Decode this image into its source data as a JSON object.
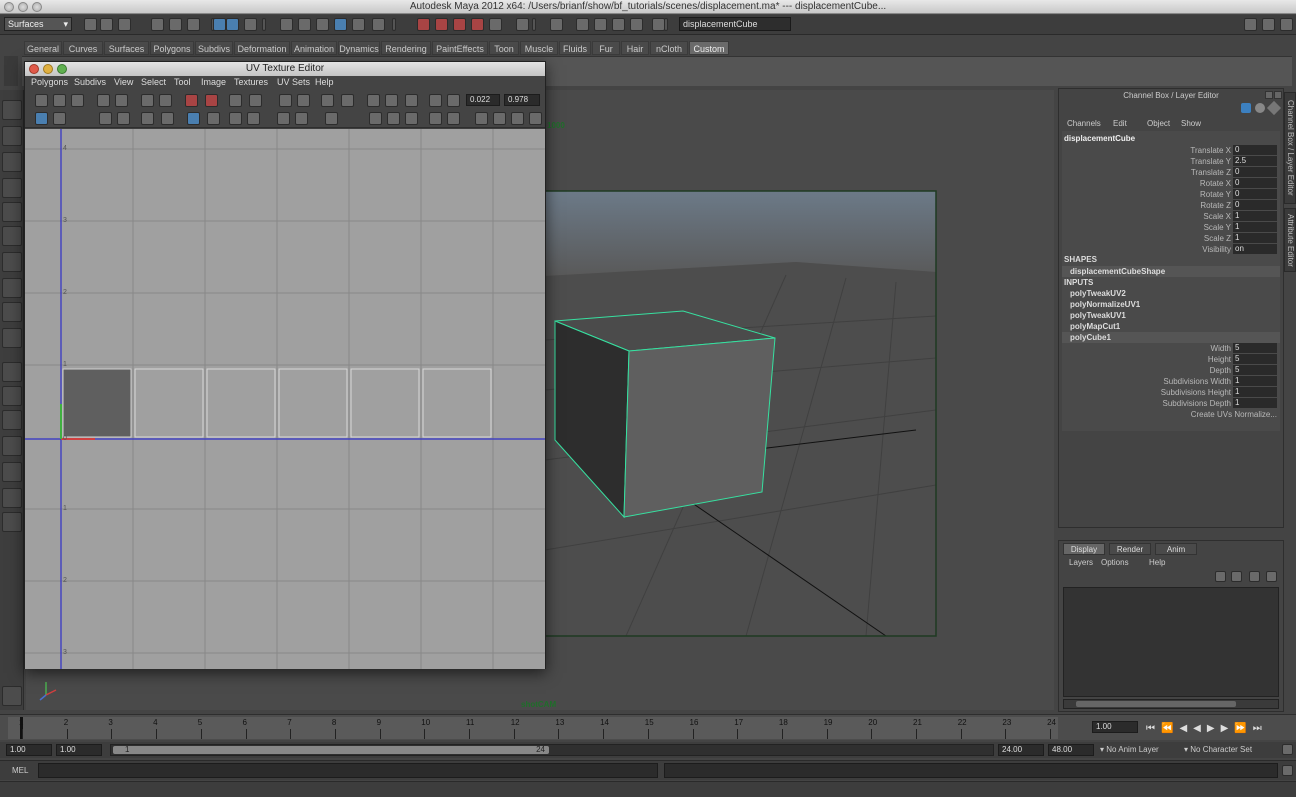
{
  "window": {
    "title": "Autodesk Maya 2012 x64: /Users/brianf/show/bf_tutorials/scenes/displacement.ma*   ---   displacementCube..."
  },
  "statusline": {
    "mode": "Surfaces",
    "name_field": "displacementCube"
  },
  "shelf": {
    "tabs": [
      "General",
      "Curves",
      "Surfaces",
      "Polygons",
      "Subdivs",
      "Deformation",
      "Animation",
      "Dynamics",
      "Rendering",
      "PaintEffects",
      "Toon",
      "Muscle",
      "Fluids",
      "Fur",
      "Hair",
      "nCloth",
      "Custom"
    ],
    "active_tab": "Custom"
  },
  "uv_editor": {
    "title": "UV Texture Editor",
    "menus": [
      "Polygons",
      "Subdivs",
      "View",
      "Select",
      "Tool",
      "Image",
      "Textures",
      "UV Sets",
      "Help"
    ],
    "u_value": "0.022",
    "v_value": "0.978",
    "axis_marks": [
      "4",
      "3",
      "2",
      "1",
      "0",
      "1",
      "2",
      "3"
    ]
  },
  "viewport": {
    "camera_label": "shotCAM",
    "top_label": "1000"
  },
  "channel_box": {
    "header": "Channel Box / Layer Editor",
    "menus": [
      "Channels",
      "Edit",
      "Object",
      "Show"
    ],
    "object": "displacementCube",
    "attributes": [
      {
        "label": "Translate X",
        "value": "0"
      },
      {
        "label": "Translate Y",
        "value": "2.5"
      },
      {
        "label": "Translate Z",
        "value": "0"
      },
      {
        "label": "Rotate X",
        "value": "0"
      },
      {
        "label": "Rotate Y",
        "value": "0"
      },
      {
        "label": "Rotate Z",
        "value": "0"
      },
      {
        "label": "Scale X",
        "value": "1"
      },
      {
        "label": "Scale Y",
        "value": "1"
      },
      {
        "label": "Scale Z",
        "value": "1"
      },
      {
        "label": "Visibility",
        "value": "on"
      }
    ],
    "shapes_header": "SHAPES",
    "shape": "displacementCubeShape",
    "inputs_header": "INPUTS",
    "inputs": [
      "polyTweakUV2",
      "polyNormalizeUV1",
      "polyTweakUV1",
      "polyMapCut1",
      "polyCube1"
    ],
    "input_attributes": [
      {
        "label": "Width",
        "value": "5"
      },
      {
        "label": "Height",
        "value": "5"
      },
      {
        "label": "Depth",
        "value": "5"
      },
      {
        "label": "Subdivisions Width",
        "value": "1"
      },
      {
        "label": "Subdivisions Height",
        "value": "1"
      },
      {
        "label": "Subdivisions Depth",
        "value": "1"
      },
      {
        "label": "Create UVs",
        "value": "Normalize..."
      }
    ],
    "side_tabs": [
      "Channel Box / Layer Editor",
      "Attribute Editor"
    ]
  },
  "layer_editor": {
    "tabs": [
      "Display",
      "Render",
      "Anim"
    ],
    "active_tab": "Display",
    "menus": [
      "Layers",
      "Options",
      "Help"
    ]
  },
  "time_slider": {
    "ticks": [
      "1",
      "2",
      "3",
      "4",
      "5",
      "6",
      "7",
      "8",
      "9",
      "10",
      "11",
      "12",
      "13",
      "14",
      "15",
      "16",
      "17",
      "18",
      "19",
      "20",
      "21",
      "22",
      "23",
      "24"
    ],
    "current_frame": "1.00"
  },
  "range_slider": {
    "start_time": "1.00",
    "playback_start": "1.00",
    "range_start_label": "1",
    "range_end_label": "24",
    "playback_end": "24.00",
    "end_time": "48.00",
    "anim_layer": "No Anim Layer",
    "character_set": "No Character Set"
  },
  "command_line": {
    "label": "MEL"
  }
}
